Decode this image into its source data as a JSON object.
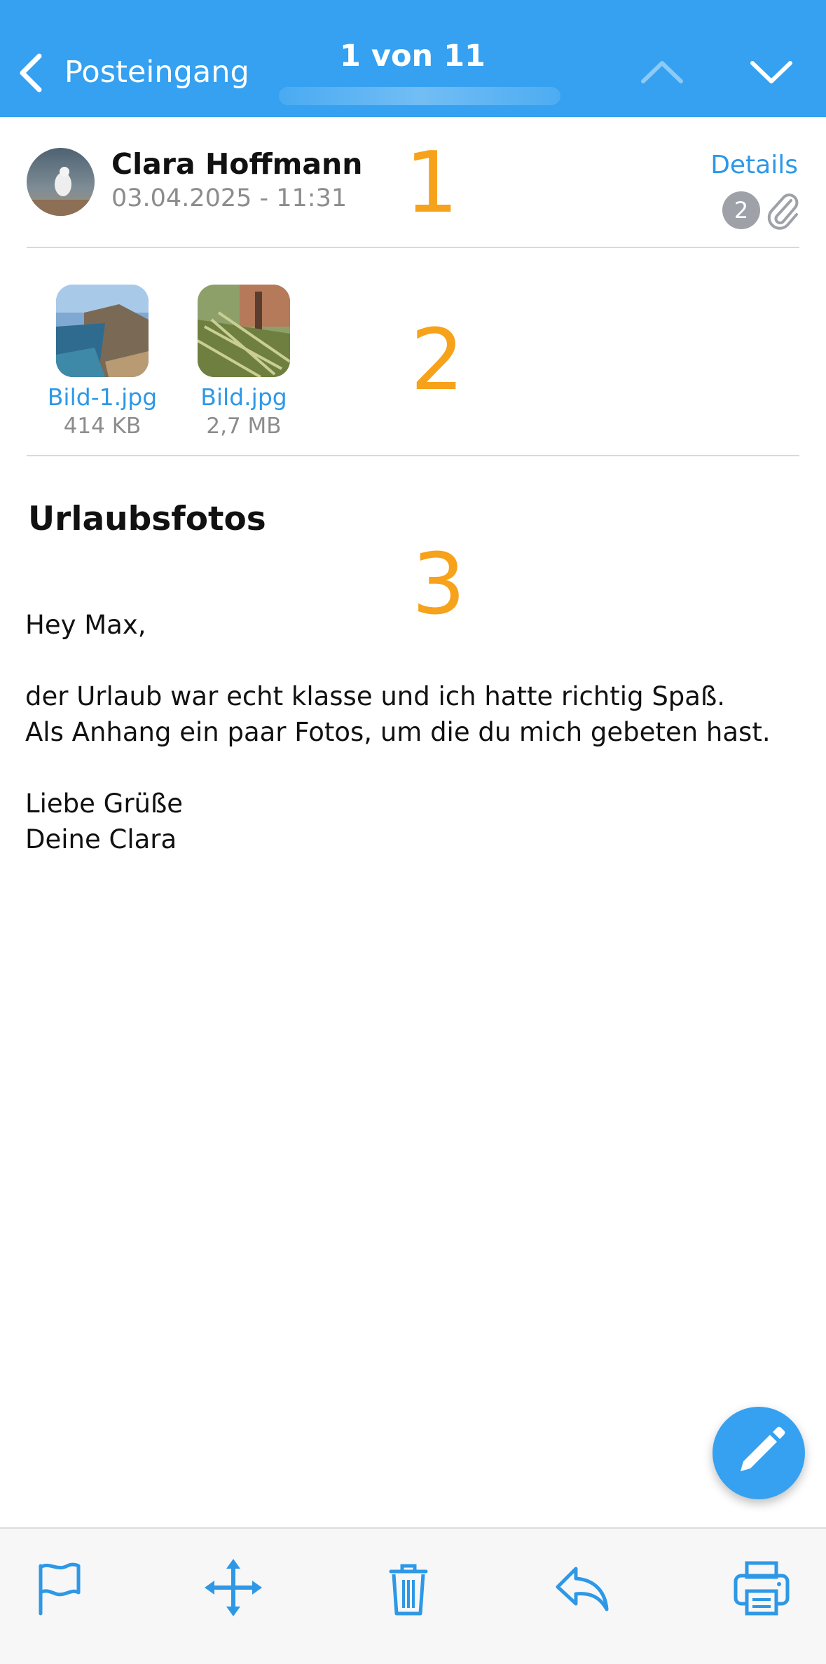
{
  "nav": {
    "back_label": "Posteingang",
    "counter": "1 von 11"
  },
  "message": {
    "sender": "Clara Hoffmann",
    "date": "03.04.2025 - 11:31",
    "details_label": "Details",
    "attachment_count": "2",
    "subject": "Urlaubsfotos",
    "body": [
      "Hey Max,",
      "der Urlaub war echt klasse und ich hatte richtig Spaß.",
      "Als Anhang ein paar Fotos, um die du mich gebeten hast.",
      "Liebe Grüße",
      "Deine Clara"
    ]
  },
  "attachments": [
    {
      "name": "Bild-1.jpg",
      "size": "414 KB"
    },
    {
      "name": "Bild.jpg",
      "size": "2,7 MB"
    }
  ],
  "annotations": [
    "1",
    "2",
    "3"
  ],
  "toolbar": {
    "icons": [
      "flag-icon",
      "move-icon",
      "trash-icon",
      "reply-icon",
      "print-icon"
    ]
  },
  "colors": {
    "accent": "#35a1f0",
    "link": "#2e98e6",
    "annotation": "#f7a21b"
  }
}
